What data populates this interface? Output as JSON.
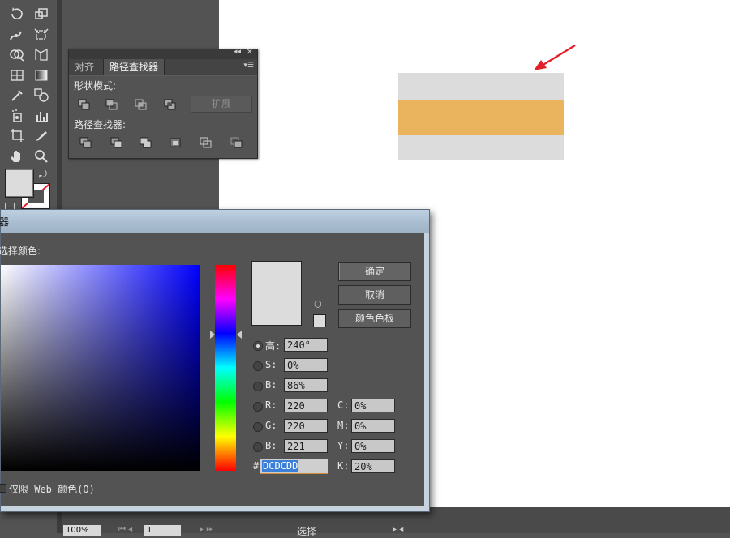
{
  "pathfinder_panel": {
    "tabs": [
      "对齐",
      "路径查找器"
    ],
    "shape_modes_label": "形状模式:",
    "expand_label": "扩展",
    "pathfinders_label": "路径查找器:"
  },
  "artwork": {
    "light_color": "#dcdcdd",
    "accent_color": "#eab45f",
    "arrow_color": "#e3202a"
  },
  "color_picker": {
    "title": "器",
    "select_color_label": "选择颜色:",
    "ok_label": "确定",
    "cancel_label": "取消",
    "swatches_label": "颜色色板",
    "hsb": [
      {
        "label": "高:",
        "value": "240°"
      },
      {
        "label": "S:",
        "value": "0%"
      },
      {
        "label": "B:",
        "value": "86%"
      }
    ],
    "rgb": [
      {
        "label": "R:",
        "value": "220"
      },
      {
        "label": "G:",
        "value": "220"
      },
      {
        "label": "B:",
        "value": "221"
      }
    ],
    "cmyk": [
      {
        "label": "C:",
        "value": "0%"
      },
      {
        "label": "M:",
        "value": "0%"
      },
      {
        "label": "Y:",
        "value": "0%"
      },
      {
        "label": "K:",
        "value": "20%"
      }
    ],
    "hex_label": "#",
    "hex_value": "DCDCDD",
    "web_only_label": "仅限 Web 颜色(O)",
    "new_color": "#dcdcdd"
  },
  "statusbar": {
    "zoom": "100%",
    "artboard_number": "1",
    "status_text": "选择"
  }
}
